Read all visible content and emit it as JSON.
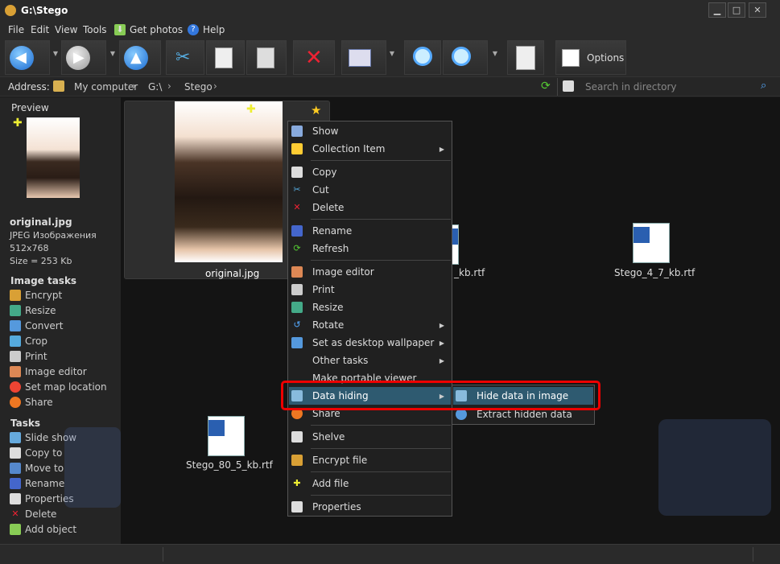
{
  "window": {
    "title": "G:\\Stego"
  },
  "menu": {
    "file": "File",
    "edit": "Edit",
    "view": "View",
    "tools": "Tools",
    "get_photos": "Get photos",
    "help": "Help"
  },
  "toolbar": {
    "options": "Options"
  },
  "address": {
    "label": "Address:",
    "crumbs": [
      "My computer",
      "G:\\",
      "Stego"
    ],
    "search_placeholder": "Search in directory"
  },
  "sidebar": {
    "preview_label": "Preview",
    "file_name": "original.jpg",
    "file_type": "JPEG Изображения",
    "file_dims": "512x768",
    "file_size": "Size = 253 Kb",
    "image_tasks_title": "Image tasks",
    "image_tasks": [
      "Encrypt",
      "Resize",
      "Convert",
      "Crop",
      "Print",
      "Image editor",
      "Set map location",
      "Share"
    ],
    "tasks_title": "Tasks",
    "tasks": [
      "Slide show",
      "Copy to",
      "Move to",
      "Rename",
      "Properties",
      "Delete",
      "Add object"
    ]
  },
  "files": {
    "selected": "original.jpg",
    "file2": "_kb.rtf",
    "file3": "Stego_4_7_kb.rtf",
    "file4": "Stego_80_5_kb.rtf"
  },
  "context_menu": {
    "show": "Show",
    "collection_item": "Collection Item",
    "copy": "Copy",
    "cut": "Cut",
    "delete": "Delete",
    "rename": "Rename",
    "refresh": "Refresh",
    "image_editor": "Image editor",
    "print": "Print",
    "resize": "Resize",
    "rotate": "Rotate",
    "set_wallpaper": "Set as desktop wallpaper",
    "other_tasks": "Other tasks",
    "make_portable_viewer": "Make portable viewer",
    "data_hiding": "Data hiding",
    "share": "Share",
    "shelve": "Shelve",
    "encrypt_file": "Encrypt file",
    "add_file": "Add file",
    "properties": "Properties"
  },
  "submenu": {
    "hide_data": "Hide data in image",
    "extract_data": "Extract hidden data"
  },
  "colors": {
    "highlight_border": "#e00000",
    "menu_selected": "#2e5a70",
    "accent_blue": "#2a7ad8"
  }
}
